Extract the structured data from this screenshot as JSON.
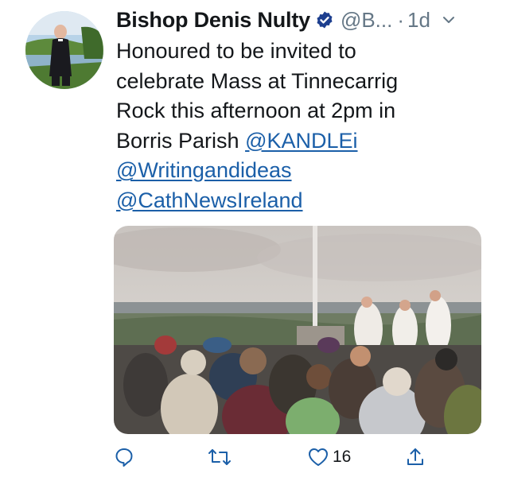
{
  "tweet": {
    "author_name": "Bishop Denis Nulty",
    "handle": "@B...",
    "separator": "·",
    "time": "1d",
    "text_line1": "Honoured to be invited to",
    "text_line2": "celebrate Mass at Tinnecarrig",
    "text_line3": "Rock this afternoon at 2pm in",
    "text_line4_prefix": "Borris Parish",
    "mentions": [
      "@KANDLEi",
      "@Writingandideas",
      "@CathNewsIreland"
    ]
  },
  "actions": {
    "like_count": "16"
  },
  "colors": {
    "verified": "#1da1f2",
    "link": "#1b5fa8",
    "muted": "#657786",
    "icon": "#1b5fa8"
  },
  "icons": [
    "verified-badge-icon",
    "chevron-down-icon",
    "reply-icon",
    "retweet-icon",
    "like-icon",
    "share-icon"
  ]
}
